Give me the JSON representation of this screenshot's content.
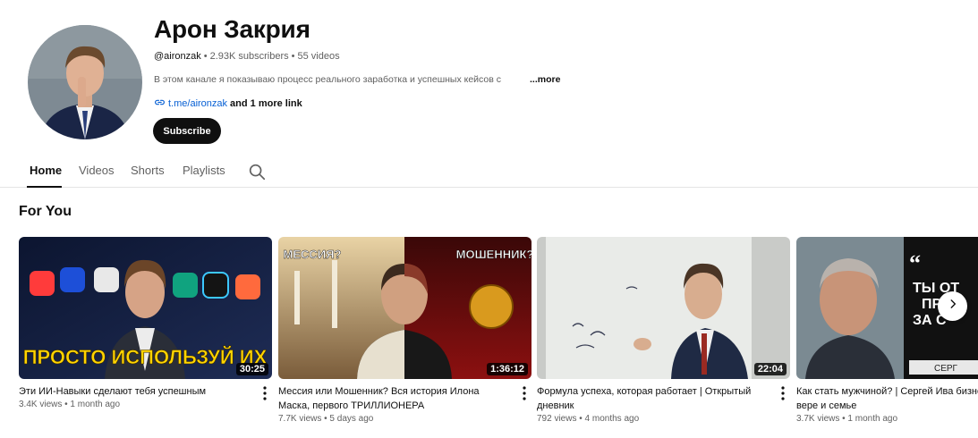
{
  "channel": {
    "name": "Арон Закрия",
    "handle": "@aironzak",
    "subscribers": "2.93K subscribers",
    "videos_count": "55 videos",
    "description": "В этом канале я показываю процесс реального заработка и успешных кейсов с",
    "more_label": "...more",
    "link_text": "t.me/aironzak",
    "more_links": "and 1 more link",
    "subscribe_label": "Subscribe"
  },
  "tabs": [
    {
      "label": "Home",
      "active": true
    },
    {
      "label": "Videos",
      "active": false
    },
    {
      "label": "Shorts",
      "active": false
    },
    {
      "label": "Playlists",
      "active": false
    }
  ],
  "section_title": "For You",
  "videos": [
    {
      "title": "Эти ИИ-Навыки сделают тебя успешным",
      "views": "3.4K views",
      "age": "1 month ago",
      "duration": "30:25",
      "thumb_text": [
        "ПРОСТО ИСПОЛЬЗУЙ ИХ"
      ]
    },
    {
      "title": "Мессия или Мошенник? Вся история Илона Маска, первого ТРИЛЛИОНЕРА",
      "views": "7.7K views",
      "age": "5 days ago",
      "duration": "1:36:12",
      "thumb_text": [
        "МЕССИЯ?",
        "МОШЕННИК?"
      ]
    },
    {
      "title": "Формула успеха, которая работает | Открытый дневник",
      "views": "792 views",
      "age": "4 months ago",
      "duration": "22:04",
      "thumb_text": []
    },
    {
      "title": "Как стать мужчиной? | Сергей Ива бизнесе, вере и семье",
      "views": "3.7K views",
      "age": "1 month ago",
      "duration": "",
      "thumb_text": [
        "ТЫ ОТ",
        "ПР",
        "ЗА С",
        "СЕРГ"
      ]
    }
  ],
  "colors": {
    "accent": "#0f0f0f",
    "link": "#065fd4",
    "muted": "#606060",
    "thumb1_headline": "#ffd400"
  },
  "icons": {
    "search": "search-icon",
    "link": "link-icon",
    "more_vert": "more-vert-icon",
    "next": "chevron-right-icon"
  }
}
